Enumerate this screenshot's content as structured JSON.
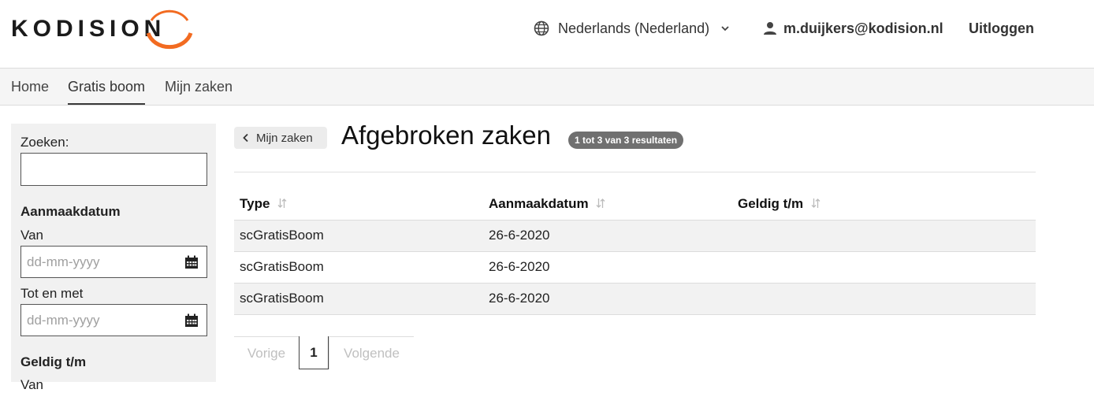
{
  "header": {
    "logo_text": "KODISION",
    "language": "Nederlands (Nederland)",
    "user_email": "m.duijkers@kodision.nl",
    "logout_label": "Uitloggen",
    "brand_color": "#f26b21"
  },
  "nav": {
    "items": [
      {
        "label": "Home"
      },
      {
        "label": "Gratis boom"
      },
      {
        "label": "Mijn zaken"
      }
    ],
    "active": "Gratis boom"
  },
  "sidebar": {
    "search_label": "Zoeken:",
    "search_value": "",
    "created_heading": "Aanmaakdatum",
    "from_label": "Van",
    "from_placeholder": "dd-mm-yyyy",
    "to_label": "Tot en met",
    "to_placeholder": "dd-mm-yyyy",
    "valid_heading": "Geldig t/m",
    "valid_from_label": "Van"
  },
  "main": {
    "back_label": "Mijn zaken",
    "title": "Afgebroken zaken",
    "result_badge": "1 tot 3 van 3 resultaten",
    "columns": [
      "Type",
      "Aanmaakdatum",
      "Geldig t/m"
    ],
    "rows": [
      {
        "type": "scGratisBoom",
        "created": "26-6-2020",
        "valid": ""
      },
      {
        "type": "scGratisBoom",
        "created": "26-6-2020",
        "valid": ""
      },
      {
        "type": "scGratisBoom",
        "created": "26-6-2020",
        "valid": ""
      }
    ]
  },
  "pagination": {
    "prev_label": "Vorige",
    "current_page": "1",
    "next_label": "Volgende"
  }
}
